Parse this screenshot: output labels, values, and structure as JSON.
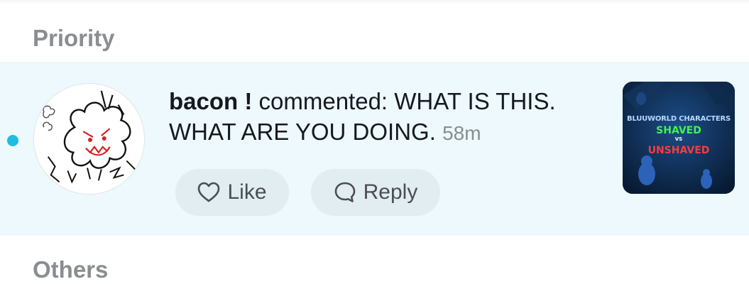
{
  "sections": {
    "priority_label": "Priority",
    "others_label": "Others"
  },
  "notification": {
    "author": "bacon !",
    "action": "commented:",
    "comment": "WHAT IS THIS. WHAT ARE YOU DOING.",
    "time": "58m",
    "unread": true,
    "accent_color": "#1fbde0",
    "row_background": "#edf9fc",
    "like_label": "Like",
    "reply_label": "Reply",
    "thumbnail": {
      "line1": "BLUUWORLD CHARACTERS",
      "line2": "SHAVED",
      "line3": "VS",
      "line4": "UNSHAVED"
    }
  },
  "icons": {
    "like": "heart-outline-icon",
    "reply": "speech-bubble-icon"
  }
}
